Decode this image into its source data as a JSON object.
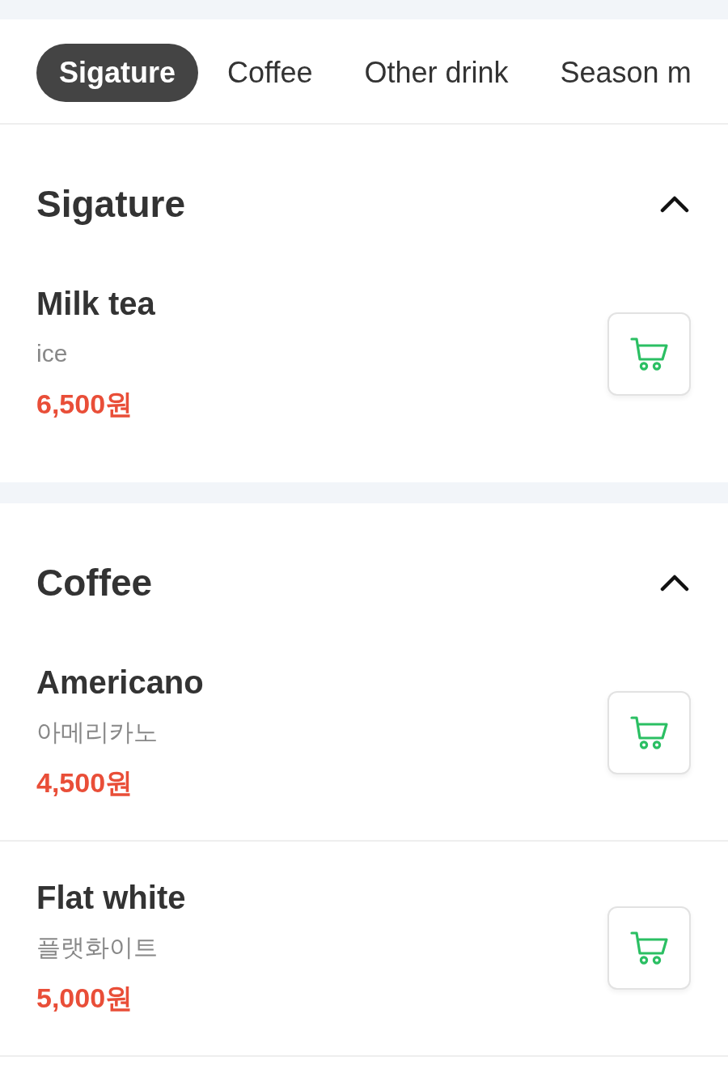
{
  "tabs": [
    {
      "label": "Sigature",
      "selected": true
    },
    {
      "label": "Coffee",
      "selected": false
    },
    {
      "label": "Other drink",
      "selected": false
    },
    {
      "label": "Season m",
      "selected": false
    }
  ],
  "sections": [
    {
      "title": "Sigature",
      "expanded": true,
      "items": [
        {
          "name": "Milk tea",
          "subtitle": "ice",
          "price": "6,500원"
        }
      ]
    },
    {
      "title": "Coffee",
      "expanded": true,
      "items": [
        {
          "name": "Americano",
          "subtitle": "아메리카노",
          "price": "4,500원"
        },
        {
          "name": "Flat white",
          "subtitle": "플랫화이트",
          "price": "5,000원"
        }
      ]
    }
  ]
}
